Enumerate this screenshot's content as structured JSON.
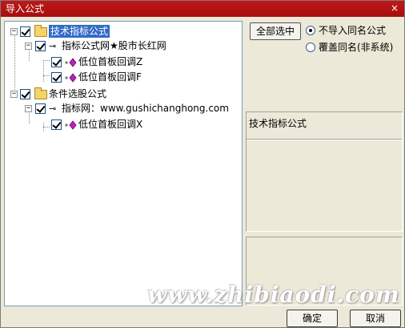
{
  "window": {
    "title": "导入公式",
    "close_glyph": "×",
    "title_bar_color": "#b01212"
  },
  "tree": {
    "groups": [
      {
        "label": "技术指标公式",
        "checked": true,
        "expanded": true,
        "selected": true,
        "children": [
          {
            "label": "指标公式网★股市长红网",
            "checked": true,
            "expanded": true,
            "children": [
              {
                "label": "低位首板回调Z",
                "checked": true
              },
              {
                "label": "低位首板回调F",
                "checked": true
              }
            ]
          }
        ]
      },
      {
        "label": "条件选股公式",
        "checked": true,
        "expanded": true,
        "selected": false,
        "children": [
          {
            "label": "指标网：www.gushichanghong.com",
            "checked": true,
            "expanded": true,
            "children": [
              {
                "label": "低位首板回调X",
                "checked": true
              }
            ]
          }
        ]
      }
    ],
    "expander_glyph": "−",
    "folder_icon": "folder-icon",
    "key_icon_glyph": "⊸",
    "formula_icon": "formula-icon"
  },
  "options": {
    "select_all_label": "全部选中",
    "radio_skip_label": "不导入同名公式",
    "radio_overwrite_label": "覆盖同名(非系统)",
    "selected": "skip"
  },
  "info": {
    "type_label": "技术指标公式"
  },
  "footer": {
    "ok_label": "确定",
    "cancel_label": "取消"
  },
  "watermark": "www.zhibiaodi.com"
}
